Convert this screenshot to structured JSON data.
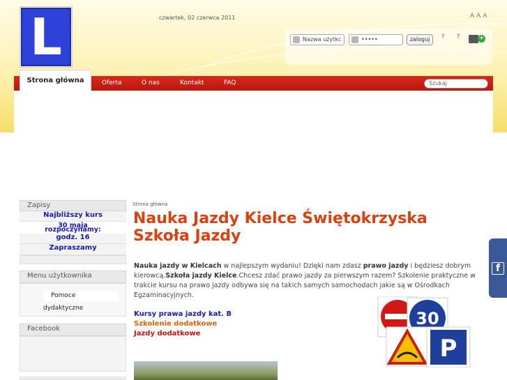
{
  "header": {
    "logo_letter": "L",
    "date": "czwartek, 02 czerwca 2011",
    "font_controls": [
      "A",
      "A",
      "A"
    ]
  },
  "login": {
    "username_placeholder": "Nazwa użytkc",
    "password_value": "•••••",
    "login_button": "zaloguj",
    "help_icons": [
      "?",
      "?"
    ]
  },
  "nav": {
    "items": [
      "Strona główna",
      "Oferta",
      "O nas",
      "Kontakt",
      "FAQ"
    ],
    "search_placeholder": "Szukaj"
  },
  "sidebar": {
    "zapisy": {
      "title": "Zapisy",
      "lines": [
        "Najbliższy kurs",
        "30 maja",
        "rozpoczynamy:",
        "godz. 16",
        "Zapraszamy"
      ]
    },
    "menu": {
      "title": "Menu użytkownika",
      "items": [
        "Pomoce",
        "dydaktyczne"
      ]
    },
    "facebook": {
      "title": "Facebook"
    }
  },
  "main": {
    "breadcrumb": "Strona główna",
    "title": "Nauka Jazdy Kielce Świętokrzyska Szkoła Jazdy",
    "intro": {
      "b1": "Nauka jazdy w Kielcach",
      "t1": " w najlepszym wydaniu! Dzięki nam zdasz ",
      "b2": "prawo jazdy",
      "t2": " i będziesz dobrym kierowcą.",
      "b3": "Szkoła jazdy Kielce",
      "t3": ".Chcesz zdać prawo jazdy za pierwszym razem? Szkolenie praktyczne w trakcie kursu na prawo jazdy odbywa się na takich samych samochodach jakie są w Ośrodkach Egzaminacyjnych."
    },
    "links": [
      {
        "label": "Kursy prawa jazdy kat. B",
        "color": "#1a1ab3"
      },
      {
        "label": "Szkolenie dodatkowe",
        "color": "#e06010"
      },
      {
        "label": "Jazdy dodatkowe",
        "color": "#cc1010"
      }
    ],
    "signs": {
      "speed": "30",
      "parking": "P"
    }
  },
  "facebook_tab": {
    "letter": "f"
  },
  "colors": {
    "nav_red": "#c8200f",
    "title_orange": "#d9420f",
    "link_blue": "#1717b8",
    "logo_blue": "#2f42d8",
    "facebook_blue": "#3b5998"
  }
}
